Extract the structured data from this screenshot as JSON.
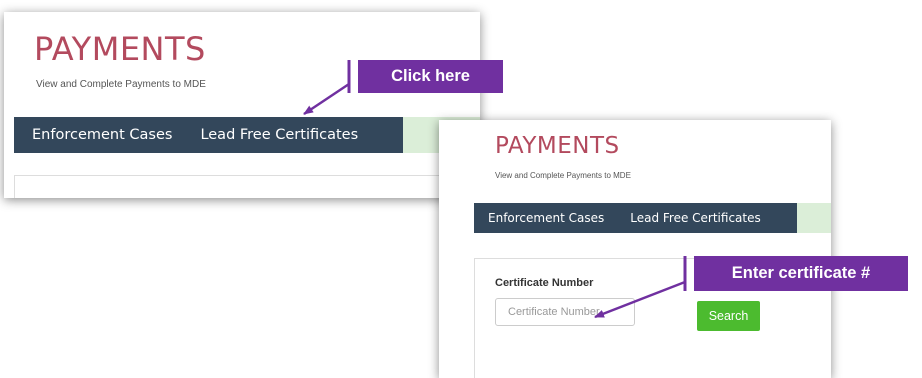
{
  "panel_top": {
    "title": "PAYMENTS",
    "subtitle": "View and Complete Payments to MDE",
    "tabs": [
      "Enforcement Cases",
      "Lead Free Certificates"
    ]
  },
  "panel_bottom": {
    "title": "PAYMENTS",
    "subtitle": "View and Complete Payments to MDE",
    "tabs": [
      "Enforcement Cases",
      "Lead Free Certificates"
    ],
    "search_form": {
      "label": "Certificate Number",
      "input_placeholder": "Certificate Number",
      "input_value": "",
      "button_label": "Search"
    }
  },
  "annotations": {
    "click_here": "Click here",
    "enter_certificate": "Enter certificate #"
  },
  "colors": {
    "title": "#b34a5e",
    "navbar": "#33475b",
    "nav_extension": "#dbeed8",
    "search_button": "#4cbb2f",
    "callout": "#7030a0"
  }
}
